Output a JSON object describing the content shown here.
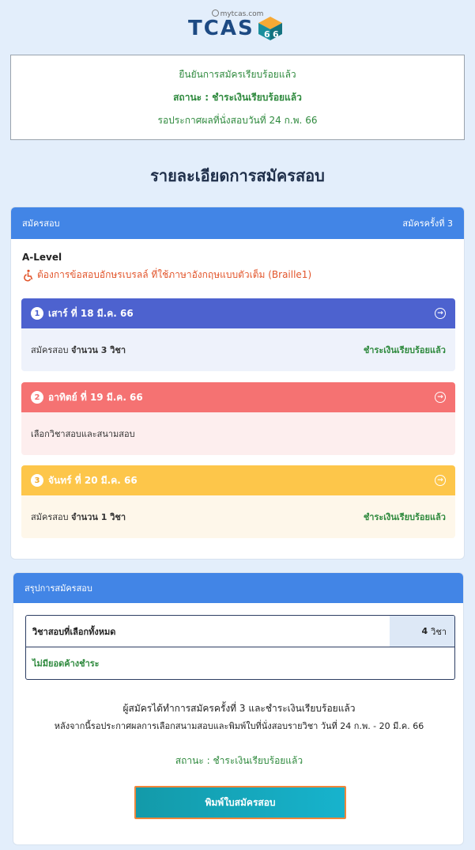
{
  "logo": {
    "site": "mytcas.com",
    "brand": "TCAS",
    "year": "66"
  },
  "confirmation": {
    "line1": "ยืนยันการสมัครเรียบร้อยแล้ว",
    "status": "สถานะ : ชำระเงินเรียบร้อยแล้ว",
    "line3": "รอประกาศผลที่นั่งสอบวันที่ 24 ก.พ. 66"
  },
  "page_title": "รายละเอียดการสมัครสอบ",
  "application": {
    "header_left": "สมัครสอบ",
    "header_right": "สมัครครั้งที่ 3",
    "exam": "A-Level",
    "braille": "ต้องการข้อสอบอักษรเบรลล์ ที่ใช้ภาษาอังกฤษแบบตัวเต็ม (Braille1)",
    "days": [
      {
        "num": "1",
        "label": "เสาร์ ที่ 18 มี.ค. 66",
        "body_prefix": "สมัครสอบ",
        "body_bold": "จำนวน 3 วิชา",
        "status": "ชำระเงินเรียบร้อยแล้ว",
        "color": "#4d62cf",
        "bg": "#eef2fb"
      },
      {
        "num": "2",
        "label": "อาทิตย์ ที่ 19 มี.ค. 66",
        "body_prefix": "เลือกวิชาสอบและสนามสอบ",
        "body_bold": "",
        "status": "",
        "color": "#f57272",
        "bg": "#fdeeee"
      },
      {
        "num": "3",
        "label": "จันทร์ ที่ 20 มี.ค. 66",
        "body_prefix": "สมัครสอบ",
        "body_bold": "จำนวน 1 วิชา",
        "status": "ชำระเงินเรียบร้อยแล้ว",
        "color": "#fdc64a",
        "bg": "#fef7ea"
      }
    ]
  },
  "summary": {
    "header": "สรุปการสมัครสอบ",
    "total_label": "วิชาสอบที่เลือกทั้งหมด",
    "total_count": "4",
    "total_unit": "วิชา",
    "no_balance": "ไม่มียอดค้างชำระ",
    "note1": "ผู้สมัครได้ทำการสมัครครั้งที่ 3 และชำระเงินเรียบร้อยแล้ว",
    "note2": "หลังจากนี้รอประกาศผลการเลือกสนามสอบและพิมพ์ใบที่นั่งสอบรายวิชา วันที่ 24 ก.พ. - 20 มี.ค. 66",
    "status": "สถานะ : ชำระเงินเรียบร้อยแล้ว",
    "print_button": "พิมพ์ใบสมัครสอบ"
  },
  "colors": {
    "accent": "#4285e6",
    "success": "#2f8a3e",
    "warning": "#e2552b",
    "button_border": "#f0863a"
  }
}
